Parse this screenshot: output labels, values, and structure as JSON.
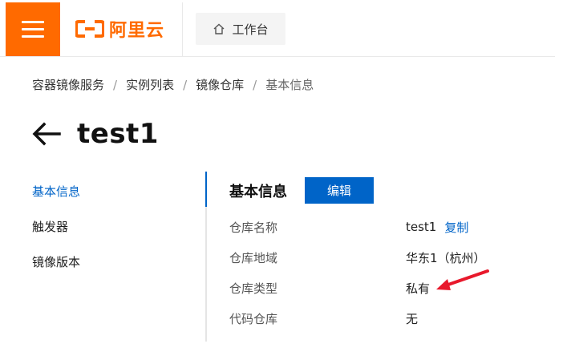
{
  "topbar": {
    "logo_text": "阿里云",
    "workbench_label": "工作台",
    "brand_color": "#ff6a00"
  },
  "breadcrumb": [
    "容器镜像服务",
    "实例列表",
    "镜像仓库",
    "基本信息"
  ],
  "page": {
    "title": "test1"
  },
  "sidenav": {
    "items": [
      {
        "label": "基本信息",
        "active": true
      },
      {
        "label": "触发器",
        "active": false
      },
      {
        "label": "镜像版本",
        "active": false
      }
    ]
  },
  "section": {
    "title": "基本信息",
    "edit_label": "编辑",
    "rows": [
      {
        "label": "仓库名称",
        "value": "test1",
        "action": "复制"
      },
      {
        "label": "仓库地域",
        "value": "华东1（杭州）"
      },
      {
        "label": "仓库类型",
        "value": "私有"
      },
      {
        "label": "代码仓库",
        "value": "无"
      }
    ]
  },
  "colors": {
    "accent": "#0064c8",
    "annotation": "#e8192c"
  },
  "icons": [
    "menu-icon",
    "aliyun-logo-icon",
    "home-icon",
    "back-arrow-icon",
    "annotation-arrow-icon"
  ]
}
